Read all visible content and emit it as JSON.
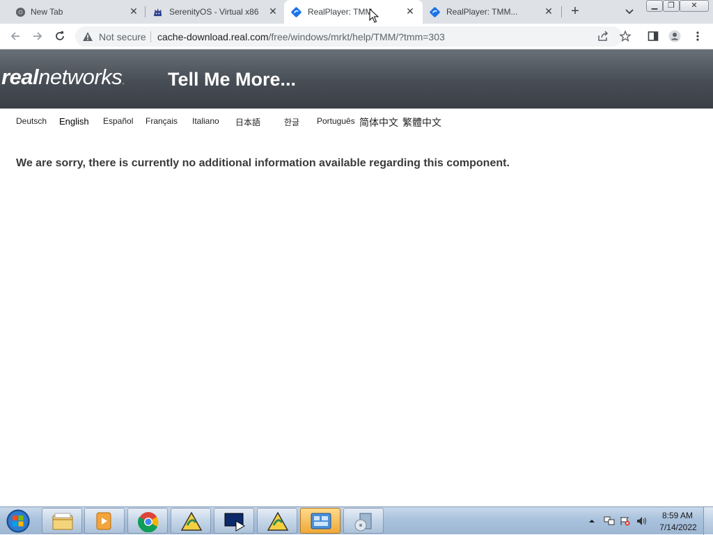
{
  "browser": {
    "tabs": [
      {
        "title": "New Tab",
        "icon": "chrome-icon"
      },
      {
        "title": "SerenityOS - Virtual x86",
        "icon": "serenityos-icon"
      },
      {
        "title": "RealPlayer: TMM",
        "icon": "realplayer-icon",
        "active": true
      },
      {
        "title": "RealPlayer: TMM...",
        "icon": "realplayer-icon"
      }
    ],
    "new_tab_label": "+",
    "close_glyph": "✕",
    "security_label": "Not secure",
    "url_host": "cache-download.real.com",
    "url_path": "/free/windows/mrkt/help/TMM/?tmm=303"
  },
  "page": {
    "logo_bold": "real",
    "logo_light": "networks",
    "logo_mark": ".",
    "header_title": "Tell Me More...",
    "languages": [
      "Deutsch",
      "English",
      "Español",
      "Français",
      "Italiano",
      "日本語",
      "한글",
      "Português",
      "简体中文",
      "繁體中文"
    ],
    "selected_language": "English",
    "message": "We are sorry, there is currently no additional information available regarding this component."
  },
  "taskbar": {
    "items": [
      "explorer-icon",
      "media-player-icon",
      "chrome-icon",
      "realplayer-installer-icon",
      "real-player-icon",
      "realplayer-installer-icon",
      "control-panel-icon",
      "disc-setup-icon"
    ],
    "active_index": 6,
    "clock_time": "8:59 AM",
    "clock_date": "7/14/2022"
  },
  "colors": {
    "header_dark": "#3a3f46",
    "tab_strip": "#dee1e6",
    "taskbar": "#a9c2dd"
  }
}
